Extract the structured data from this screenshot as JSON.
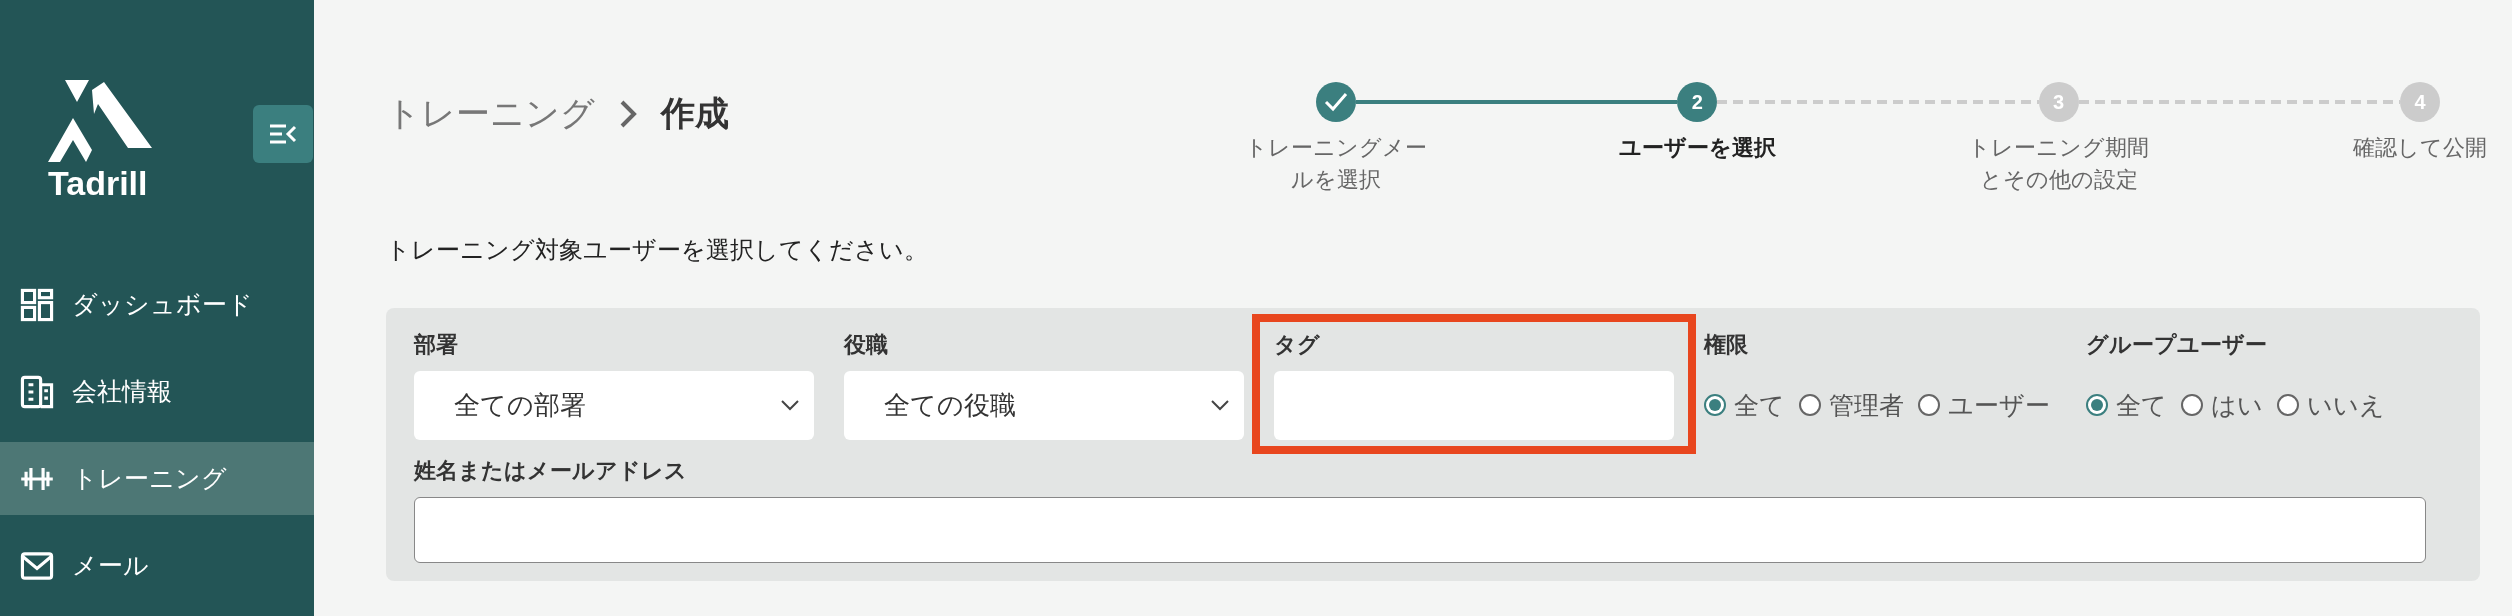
{
  "sidebar": {
    "logo": "Tadrill",
    "items": [
      {
        "label": "ダッシュボード",
        "selected": false
      },
      {
        "label": "会社情報",
        "selected": false
      },
      {
        "label": "トレーニング",
        "selected": true
      },
      {
        "label": "メール",
        "selected": false
      }
    ]
  },
  "breadcrumb": [
    "トレーニング",
    "作成"
  ],
  "stepper": [
    {
      "label": "トレーニングメールを選択",
      "done": true,
      "selected": false
    },
    {
      "number": "2",
      "label": "ユーザーを選択",
      "done": false,
      "selected": true
    },
    {
      "number": "3",
      "label": "トレーニング期間とその他の設定",
      "done": false,
      "selected": false
    },
    {
      "number": "4",
      "label": "確認して公開",
      "done": false,
      "selected": false
    }
  ],
  "instruction": "トレーニング対象ユーザーを選択してください。",
  "filters": [
    {
      "kind": "select",
      "label": "部署",
      "value": "全ての部署"
    },
    {
      "kind": "select",
      "label": "役職",
      "value": "全ての役職"
    },
    {
      "kind": "text",
      "label": "タグ",
      "highlighted": true
    },
    {
      "kind": "radio",
      "label": "権限",
      "options": [
        {
          "label": "全て",
          "selected": true
        },
        {
          "label": "管理者",
          "selected": false
        },
        {
          "label": "ユーザー",
          "selected": false
        }
      ]
    },
    {
      "kind": "radio",
      "label": "グループユーザー",
      "options": [
        {
          "label": "全て",
          "selected": true
        },
        {
          "label": "はい",
          "selected": false
        },
        {
          "label": "いいえ",
          "selected": false
        }
      ]
    }
  ],
  "name_search": {
    "label": "姓名またはメールアドレス"
  }
}
